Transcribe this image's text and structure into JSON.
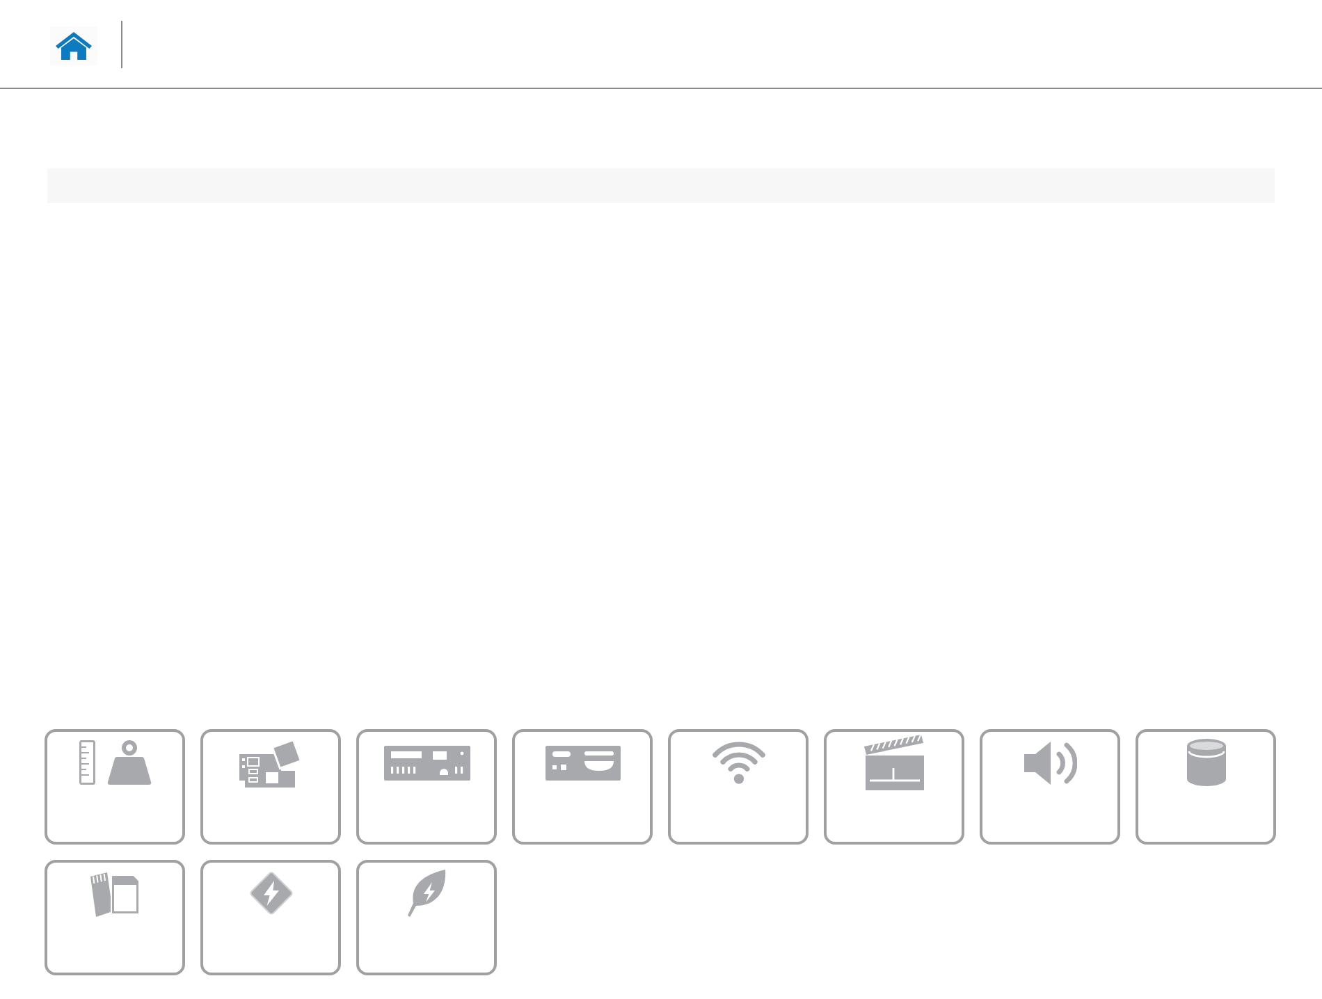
{
  "tiles": [
    {
      "kind": "weight"
    },
    {
      "kind": "board"
    },
    {
      "kind": "panel"
    },
    {
      "kind": "minipanel"
    },
    {
      "kind": "wifi"
    },
    {
      "kind": "clapper"
    },
    {
      "kind": "speaker"
    },
    {
      "kind": "cylinder"
    },
    {
      "kind": "card"
    },
    {
      "kind": "bolt"
    },
    {
      "kind": "leaf"
    }
  ]
}
